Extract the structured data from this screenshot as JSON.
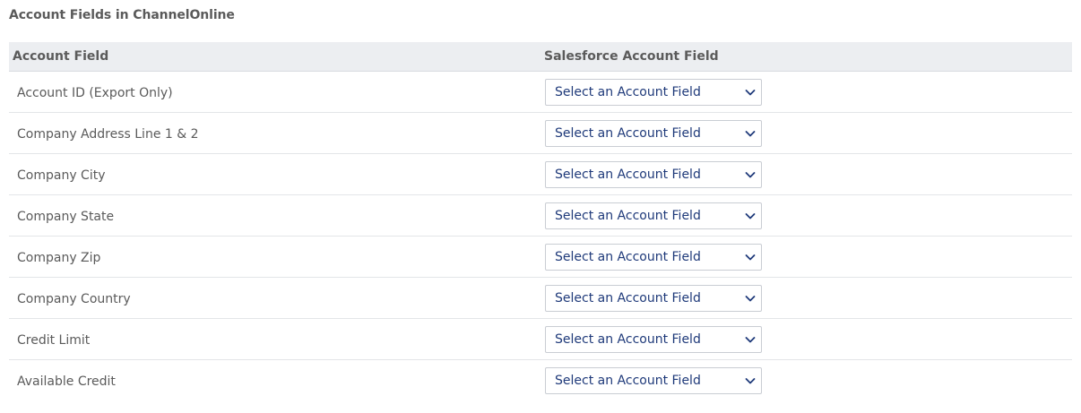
{
  "section": {
    "title": "Account Fields in ChannelOnline"
  },
  "table": {
    "headers": {
      "account_field": "Account Field",
      "salesforce_field": "Salesforce Account Field"
    },
    "rows": [
      {
        "label": "Account ID (Export Only)",
        "select_value": "Select an Account Field"
      },
      {
        "label": "Company Address Line 1 & 2",
        "select_value": "Select an Account Field"
      },
      {
        "label": "Company City",
        "select_value": "Select an Account Field"
      },
      {
        "label": "Company State",
        "select_value": "Select an Account Field"
      },
      {
        "label": "Company Zip",
        "select_value": "Select an Account Field"
      },
      {
        "label": "Company Country",
        "select_value": "Select an Account Field"
      },
      {
        "label": "Credit Limit",
        "select_value": "Select an Account Field"
      },
      {
        "label": "Available Credit",
        "select_value": "Select an Account Field"
      }
    ]
  },
  "icons": {
    "select_arrow": "chevron-down-icon"
  },
  "colors": {
    "header_bg": "#eceef1",
    "select_text": "#1f3a7a",
    "label_text": "#5a5a5a"
  }
}
